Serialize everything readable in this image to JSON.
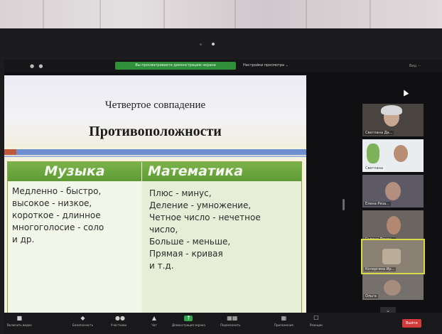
{
  "topbar": {
    "share_banner": "Вы просматриваете демонстрацию экрана",
    "view_options": "Настройки просмотра ⌄",
    "right_label": "Вид ⋯"
  },
  "slide": {
    "subtitle": "Четвертое совпадение",
    "title": "Противоположности",
    "columns": [
      {
        "header": "Музыка",
        "lines": [
          "Медленно - быстро,",
          "высокое - низкое,",
          "короткое - длинное",
          "многоголосие - соло",
          "и др."
        ]
      },
      {
        "header": "Математика",
        "lines": [
          "Плюс - минус,",
          "Деление - умножение,",
          "Четное число - нечетное",
          "число,",
          "Больше - меньше,",
          "Прямая - кривая",
          "и т.д."
        ]
      }
    ]
  },
  "gallery": {
    "participants": [
      {
        "name": "Светлана Да...",
        "muted": true
      },
      {
        "name": "Светлана",
        "muted": false
      },
      {
        "name": "Елена Ряза...",
        "muted": true
      },
      {
        "name": "Галина Печен...",
        "muted": true
      },
      {
        "name": "Кочергина Ир...",
        "muted": false
      },
      {
        "name": "Ольга",
        "muted": true
      }
    ],
    "collapse_icon": "chevron-down-icon"
  },
  "toolbar": {
    "items": [
      {
        "label": "Включить видео",
        "icon": "video-icon"
      },
      {
        "label": "Безопасность",
        "icon": "shield-icon"
      },
      {
        "label": "Участники",
        "icon": "participants-icon"
      },
      {
        "label": "Чат",
        "icon": "chat-icon"
      },
      {
        "label": "Демонстрация экрана",
        "icon": "share-screen-icon"
      },
      {
        "label": "Переключить",
        "icon": "grid-icon"
      },
      {
        "label": "Приложения",
        "icon": "apps-icon"
      },
      {
        "label": "Реакции",
        "icon": "reaction-icon"
      }
    ],
    "end_label": "Выйти"
  },
  "colors": {
    "share_banner": "#2f8f3a",
    "table_header": "#6aa73e",
    "end_button": "#d23b3b",
    "active_speaker": "#d6d94a"
  }
}
